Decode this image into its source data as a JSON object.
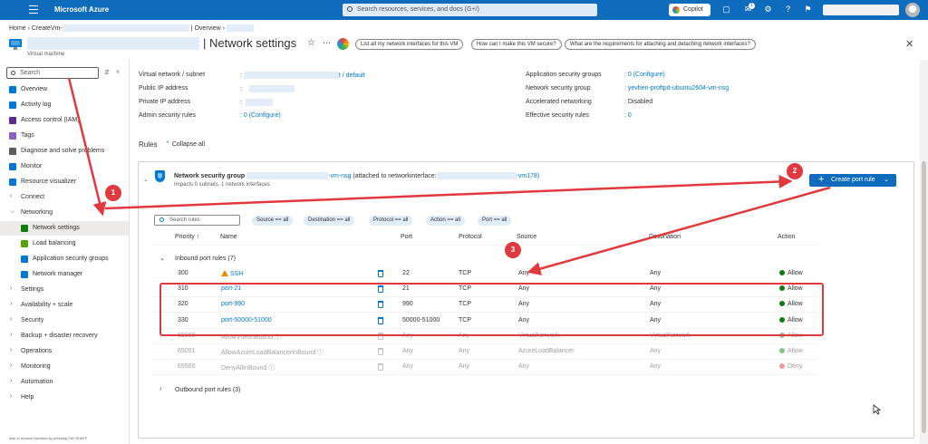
{
  "topbar": {
    "brand": "Microsoft Azure",
    "search_placeholder": "Search resources, services, and docs (G+/)",
    "copilot_label": "Copilot",
    "notifications_count": "1"
  },
  "breadcrumb": {
    "home": "Home",
    "resource": "CreateVm-",
    "page": "| Overview"
  },
  "header": {
    "title": "| Network settings",
    "subtitle": "Virtual machine",
    "prompts": [
      "List all my network interfaces for this VM",
      "How can I make this VM secure?",
      "What are the requirements for attaching and detaching network interfaces?"
    ]
  },
  "sidebar": {
    "search_placeholder": "Search",
    "items": [
      {
        "label": "Overview",
        "type": "icon",
        "color": "#0078d4"
      },
      {
        "label": "Activity log",
        "type": "icon",
        "color": "#0078d4"
      },
      {
        "label": "Access control (IAM)",
        "type": "icon",
        "color": "#5c2d91"
      },
      {
        "label": "Tags",
        "type": "icon",
        "color": "#8661c5"
      },
      {
        "label": "Diagnose and solve problems",
        "type": "icon",
        "color": "#605e5c"
      },
      {
        "label": "Monitor",
        "type": "icon",
        "color": "#0078d4"
      },
      {
        "label": "Resource visualizer",
        "type": "icon",
        "color": "#0078d4"
      },
      {
        "label": "Connect",
        "type": "chevron-right"
      },
      {
        "label": "Networking",
        "type": "chevron-down"
      },
      {
        "label": "Network settings",
        "type": "sub",
        "color": "#107c10",
        "active": true
      },
      {
        "label": "Load balancing",
        "type": "sub",
        "color": "#57a300"
      },
      {
        "label": "Application security groups",
        "type": "sub",
        "color": "#0078d4"
      },
      {
        "label": "Network manager",
        "type": "sub",
        "color": "#0078d4"
      },
      {
        "label": "Settings",
        "type": "chevron-right"
      },
      {
        "label": "Availability + scale",
        "type": "chevron-right"
      },
      {
        "label": "Security",
        "type": "chevron-right"
      },
      {
        "label": "Backup + disaster recovery",
        "type": "chevron-right"
      },
      {
        "label": "Operations",
        "type": "chevron-right"
      },
      {
        "label": "Monitoring",
        "type": "chevron-right"
      },
      {
        "label": "Automation",
        "type": "chevron-right"
      },
      {
        "label": "Help",
        "type": "chevron-right"
      }
    ],
    "footer": "Add or remove favorites by pressing Ctrl+Shift+F"
  },
  "properties": {
    "left": [
      {
        "label": "Virtual network / subnet",
        "value": "t / default",
        "link": true
      },
      {
        "label": "Public IP address",
        "value": ""
      },
      {
        "label": "Private IP address",
        "value": ""
      },
      {
        "label": "Admin security rules",
        "value": "0 (Configure)",
        "link": true
      }
    ],
    "right": [
      {
        "label": "Application security groups",
        "value": "0 (Configure)",
        "link": true
      },
      {
        "label": "Network security group",
        "value": "yevhen-proftpd-ubuntu2604-vm-nsg",
        "link": true
      },
      {
        "label": "Accelerated networking",
        "value": "Disabled"
      },
      {
        "label": "Effective security rules",
        "value": "0",
        "link": true
      }
    ]
  },
  "rules": {
    "title": "Rules",
    "collapse_all": "Collapse all",
    "nsg_prefix": "Network security group",
    "nsg_name": "-vm-nsg",
    "nsg_attached": "(attached to networkinterface:",
    "nsg_nic": "-vm178)",
    "nsg_impacts": "Impacts 0 subnets, 1 network interfaces",
    "create_button": "Create port rule",
    "filter_placeholder": "Search rules",
    "chips": [
      "Source == all",
      "Destination == all",
      "Protocol == all",
      "Action == all",
      "Port == all"
    ],
    "columns": [
      "Priority ↑",
      "Name",
      "Port",
      "Protocol",
      "Source",
      "Destination",
      "Action"
    ],
    "inbound_group": "Inbound port rules (7)",
    "outbound_group": "Outbound port rules (3)",
    "inbound_rows": [
      {
        "priority": "300",
        "name": "SSH",
        "warn": true,
        "port": "22",
        "protocol": "TCP",
        "source": "Any",
        "destination": "Any",
        "action": "Allow",
        "custom": true
      },
      {
        "priority": "310",
        "name": "port-21",
        "port": "21",
        "protocol": "TCP",
        "source": "Any",
        "destination": "Any",
        "action": "Allow",
        "custom": true
      },
      {
        "priority": "320",
        "name": "port-990",
        "port": "990",
        "protocol": "TCP",
        "source": "Any",
        "destination": "Any",
        "action": "Allow",
        "custom": true
      },
      {
        "priority": "330",
        "name": "port-50000-51000",
        "port": "50000-51000",
        "protocol": "TCP",
        "source": "Any",
        "destination": "Any",
        "action": "Allow",
        "custom": true
      },
      {
        "priority": "65000",
        "name": "AllowVnetInBound",
        "port": "Any",
        "protocol": "Any",
        "source": "VirtualNetwork",
        "destination": "VirtualNetwork",
        "action": "Allow",
        "custom": false
      },
      {
        "priority": "65001",
        "name": "AllowAzureLoadBalancerInBound",
        "port": "Any",
        "protocol": "Any",
        "source": "AzureLoadBalancer",
        "destination": "Any",
        "action": "Allow",
        "custom": false
      },
      {
        "priority": "65500",
        "name": "DenyAllInBound",
        "port": "Any",
        "protocol": "Any",
        "source": "Any",
        "destination": "Any",
        "action": "Deny",
        "custom": false
      }
    ]
  },
  "annotations": {
    "badges": [
      "1",
      "2",
      "3"
    ],
    "color": "#e0393e"
  }
}
